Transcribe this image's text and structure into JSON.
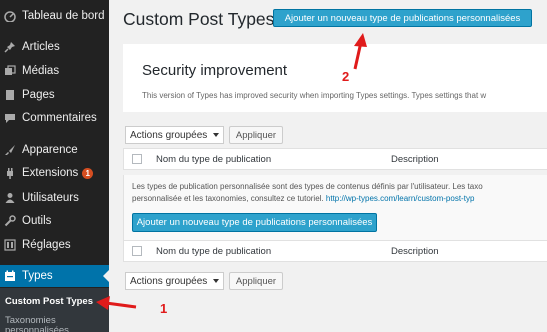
{
  "sidebar": {
    "items": [
      {
        "label": "Tableau de bord",
        "icon": "dashboard-icon"
      },
      {
        "label": "Articles",
        "icon": "pin-icon"
      },
      {
        "label": "Médias",
        "icon": "media-icon"
      },
      {
        "label": "Pages",
        "icon": "page-icon"
      },
      {
        "label": "Commentaires",
        "icon": "comment-icon"
      },
      {
        "label": "Apparence",
        "icon": "brush-icon"
      },
      {
        "label": "Extensions",
        "icon": "plugin-icon",
        "badge": "1"
      },
      {
        "label": "Utilisateurs",
        "icon": "users-icon"
      },
      {
        "label": "Outils",
        "icon": "wrench-icon"
      },
      {
        "label": "Réglages",
        "icon": "settings-icon"
      },
      {
        "label": "Types",
        "icon": "types-icon",
        "active": true
      }
    ],
    "submenu": {
      "active": "Custom Post Types",
      "next": "Taxonomies personnalisées"
    }
  },
  "main": {
    "title": "Custom Post Types",
    "add_button": "Ajouter un nouveau type de publications personnalisées",
    "notice": {
      "title": "Security improvement",
      "text": "This version of Types has improved security when importing Types settings. Types settings that w"
    },
    "bulk_top": {
      "select": "Actions groupées",
      "apply": "Appliquer"
    },
    "table": {
      "col_name": "Nom du type de publication",
      "col_desc": "Description"
    },
    "empty": {
      "line1": "Les types de publication personnalisée sont des types de contenus définis par l'utilisateur. Les taxo",
      "line2": "personnalisée et les taxonomies, consultez ce tutoriel. ",
      "link": "http://wp-types.com/learn/custom-post-typ",
      "button": "Ajouter un nouveau type de publications personnalisées"
    },
    "bulk_bottom": {
      "select": "Actions groupées",
      "apply": "Appliquer"
    }
  },
  "annotations": {
    "one": "1",
    "two": "2",
    "color": "#e01b1b"
  }
}
